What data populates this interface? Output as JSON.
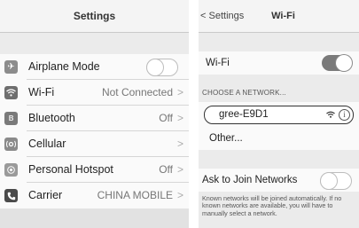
{
  "settings": {
    "title": "Settings",
    "items": [
      {
        "label": "Airplane Mode",
        "icon": "airplane-icon"
      },
      {
        "label": "Wi-Fi",
        "value": "Not Connected",
        "icon": "wifi-icon"
      },
      {
        "label": "Bluetooth",
        "value": "Off",
        "icon": "bluetooth-icon"
      },
      {
        "label": "Cellular",
        "icon": "cellular-icon"
      },
      {
        "label": "Personal Hotspot",
        "value": "Off",
        "icon": "hotspot-icon"
      },
      {
        "label": "Carrier",
        "value": "CHINA MOBILE",
        "icon": "phone-icon"
      }
    ],
    "airplane_mode_on": false
  },
  "wifi": {
    "back_label": "Settings",
    "title": "Wi-Fi",
    "toggle_label": "Wi-Fi",
    "toggle_on": true,
    "section_header": "CHOOSE A NETWORK...",
    "network_name": "gree-E9D1",
    "other_label": "Other...",
    "ask_label": "Ask to Join Networks",
    "ask_on": false,
    "footer_text": "Known networks will be joined automatically. If no known networks are available, you will have to manually select a network."
  }
}
